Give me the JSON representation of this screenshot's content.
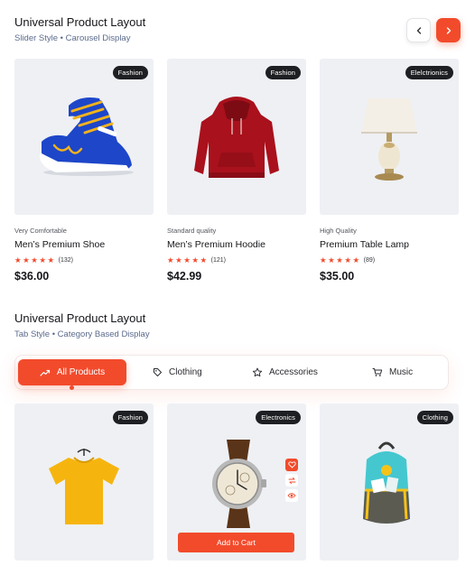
{
  "section1": {
    "title": "Universal Product Layout",
    "subtitle": "Slider Style • Carousel Display",
    "nav": {
      "prev_icon": "chevron-left-icon",
      "next_icon": "chevron-right-icon"
    },
    "products": [
      {
        "badge": "Fashion",
        "note": "Very Comfortable",
        "name": "Men’s Premium Shoe",
        "stars": "★★★★★",
        "reviews": "(132)",
        "price": "$36.00"
      },
      {
        "badge": "Fashion",
        "note": "Standard quality",
        "name": "Men’s Premium Hoodie",
        "stars": "★★★★★",
        "reviews": "(121)",
        "price": "$42.99"
      },
      {
        "badge": "Elelctrionics",
        "note": "High Quality",
        "name": "Premium Table Lamp",
        "stars": "★★★★★",
        "reviews": "(89)",
        "price": "$35.00"
      }
    ]
  },
  "section2": {
    "title": "Universal Product Layout",
    "subtitle": "Tab Style • Category Based Display",
    "tabs": [
      {
        "label": "All Products",
        "icon": "trending-up-icon",
        "active": true
      },
      {
        "label": "Clothing",
        "icon": "tag-icon",
        "active": false
      },
      {
        "label": "Accessories",
        "icon": "star-icon",
        "active": false
      },
      {
        "label": "Music",
        "icon": "cart-icon",
        "active": false
      }
    ],
    "products": [
      {
        "badge": "Fashion"
      },
      {
        "badge": "Electronics",
        "add_to_cart": "Add to Cart"
      },
      {
        "badge": "Clothing"
      }
    ]
  },
  "colors": {
    "accent": "#f24b2c",
    "card_bg": "#eef0f4",
    "badge_bg": "#1e1f22",
    "subtitle": "#5b6b8c"
  }
}
